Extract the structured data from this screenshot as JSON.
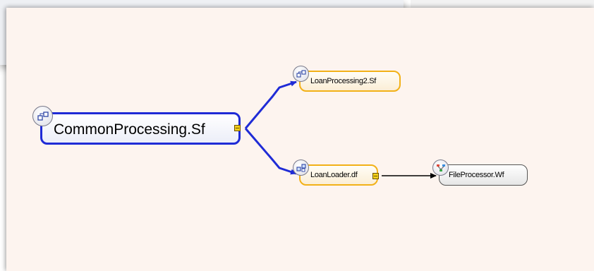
{
  "diagram": {
    "nodes": {
      "main": {
        "label": "CommonProcessing.Sf",
        "icon": "subflow-icon"
      },
      "lp2": {
        "label": "LoanProcessing2.Sf",
        "icon": "subflow-icon"
      },
      "ll": {
        "label": "LoanLoader.df",
        "icon": "dataflow-icon"
      },
      "fp": {
        "label": "FileProcessor.Wf",
        "icon": "workflow-icon"
      }
    },
    "edges": [
      {
        "from": "CommonProcessing.Sf",
        "to": "LoanProcessing2.Sf",
        "color": "#1f2bd6"
      },
      {
        "from": "CommonProcessing.Sf",
        "to": "LoanLoader.df",
        "color": "#1f2bd6"
      },
      {
        "from": "LoanLoader.df",
        "to": "FileProcessor.Wf",
        "color": "#000000"
      }
    ],
    "colors": {
      "canvas": "#fdf4ef",
      "selected_border": "#1f2bd6",
      "node_border_orange": "#f2b118",
      "connector": "#f3cf1a"
    }
  }
}
